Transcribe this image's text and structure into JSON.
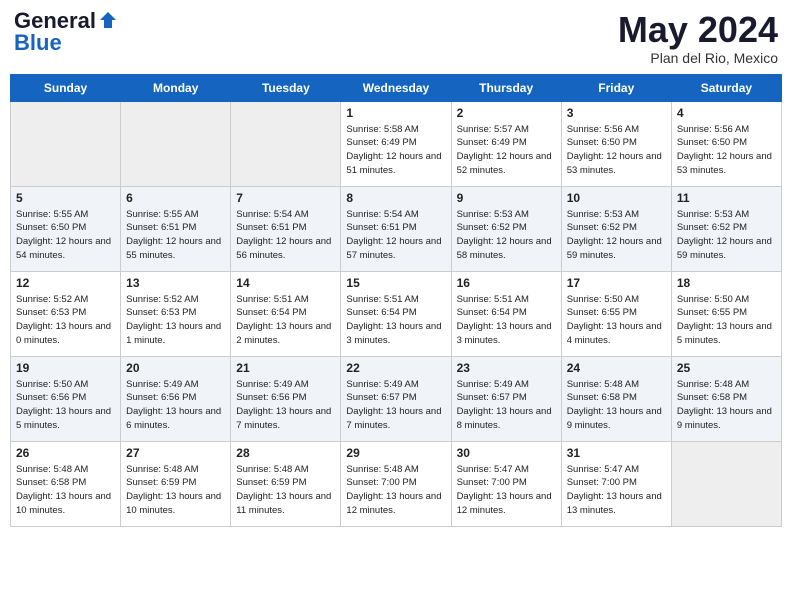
{
  "header": {
    "logo_general": "General",
    "logo_blue": "Blue",
    "month_title": "May 2024",
    "location": "Plan del Rio, Mexico"
  },
  "days_of_week": [
    "Sunday",
    "Monday",
    "Tuesday",
    "Wednesday",
    "Thursday",
    "Friday",
    "Saturday"
  ],
  "weeks": [
    {
      "row_class": "row-odd",
      "cells": [
        {
          "day": "",
          "empty": true
        },
        {
          "day": "",
          "empty": true
        },
        {
          "day": "",
          "empty": true
        },
        {
          "day": "1",
          "sunrise": "5:58 AM",
          "sunset": "6:49 PM",
          "daylight": "12 hours and 51 minutes."
        },
        {
          "day": "2",
          "sunrise": "5:57 AM",
          "sunset": "6:49 PM",
          "daylight": "12 hours and 52 minutes."
        },
        {
          "day": "3",
          "sunrise": "5:56 AM",
          "sunset": "6:50 PM",
          "daylight": "12 hours and 53 minutes."
        },
        {
          "day": "4",
          "sunrise": "5:56 AM",
          "sunset": "6:50 PM",
          "daylight": "12 hours and 53 minutes."
        }
      ]
    },
    {
      "row_class": "row-even",
      "cells": [
        {
          "day": "5",
          "sunrise": "5:55 AM",
          "sunset": "6:50 PM",
          "daylight": "12 hours and 54 minutes."
        },
        {
          "day": "6",
          "sunrise": "5:55 AM",
          "sunset": "6:51 PM",
          "daylight": "12 hours and 55 minutes."
        },
        {
          "day": "7",
          "sunrise": "5:54 AM",
          "sunset": "6:51 PM",
          "daylight": "12 hours and 56 minutes."
        },
        {
          "day": "8",
          "sunrise": "5:54 AM",
          "sunset": "6:51 PM",
          "daylight": "12 hours and 57 minutes."
        },
        {
          "day": "9",
          "sunrise": "5:53 AM",
          "sunset": "6:52 PM",
          "daylight": "12 hours and 58 minutes."
        },
        {
          "day": "10",
          "sunrise": "5:53 AM",
          "sunset": "6:52 PM",
          "daylight": "12 hours and 59 minutes."
        },
        {
          "day": "11",
          "sunrise": "5:53 AM",
          "sunset": "6:52 PM",
          "daylight": "12 hours and 59 minutes."
        }
      ]
    },
    {
      "row_class": "row-odd",
      "cells": [
        {
          "day": "12",
          "sunrise": "5:52 AM",
          "sunset": "6:53 PM",
          "daylight": "13 hours and 0 minutes."
        },
        {
          "day": "13",
          "sunrise": "5:52 AM",
          "sunset": "6:53 PM",
          "daylight": "13 hours and 1 minute."
        },
        {
          "day": "14",
          "sunrise": "5:51 AM",
          "sunset": "6:54 PM",
          "daylight": "13 hours and 2 minutes."
        },
        {
          "day": "15",
          "sunrise": "5:51 AM",
          "sunset": "6:54 PM",
          "daylight": "13 hours and 3 minutes."
        },
        {
          "day": "16",
          "sunrise": "5:51 AM",
          "sunset": "6:54 PM",
          "daylight": "13 hours and 3 minutes."
        },
        {
          "day": "17",
          "sunrise": "5:50 AM",
          "sunset": "6:55 PM",
          "daylight": "13 hours and 4 minutes."
        },
        {
          "day": "18",
          "sunrise": "5:50 AM",
          "sunset": "6:55 PM",
          "daylight": "13 hours and 5 minutes."
        }
      ]
    },
    {
      "row_class": "row-even",
      "cells": [
        {
          "day": "19",
          "sunrise": "5:50 AM",
          "sunset": "6:56 PM",
          "daylight": "13 hours and 5 minutes."
        },
        {
          "day": "20",
          "sunrise": "5:49 AM",
          "sunset": "6:56 PM",
          "daylight": "13 hours and 6 minutes."
        },
        {
          "day": "21",
          "sunrise": "5:49 AM",
          "sunset": "6:56 PM",
          "daylight": "13 hours and 7 minutes."
        },
        {
          "day": "22",
          "sunrise": "5:49 AM",
          "sunset": "6:57 PM",
          "daylight": "13 hours and 7 minutes."
        },
        {
          "day": "23",
          "sunrise": "5:49 AM",
          "sunset": "6:57 PM",
          "daylight": "13 hours and 8 minutes."
        },
        {
          "day": "24",
          "sunrise": "5:48 AM",
          "sunset": "6:58 PM",
          "daylight": "13 hours and 9 minutes."
        },
        {
          "day": "25",
          "sunrise": "5:48 AM",
          "sunset": "6:58 PM",
          "daylight": "13 hours and 9 minutes."
        }
      ]
    },
    {
      "row_class": "row-odd",
      "cells": [
        {
          "day": "26",
          "sunrise": "5:48 AM",
          "sunset": "6:58 PM",
          "daylight": "13 hours and 10 minutes."
        },
        {
          "day": "27",
          "sunrise": "5:48 AM",
          "sunset": "6:59 PM",
          "daylight": "13 hours and 10 minutes."
        },
        {
          "day": "28",
          "sunrise": "5:48 AM",
          "sunset": "6:59 PM",
          "daylight": "13 hours and 11 minutes."
        },
        {
          "day": "29",
          "sunrise": "5:48 AM",
          "sunset": "7:00 PM",
          "daylight": "13 hours and 12 minutes."
        },
        {
          "day": "30",
          "sunrise": "5:47 AM",
          "sunset": "7:00 PM",
          "daylight": "13 hours and 12 minutes."
        },
        {
          "day": "31",
          "sunrise": "5:47 AM",
          "sunset": "7:00 PM",
          "daylight": "13 hours and 13 minutes."
        },
        {
          "day": "",
          "empty": true
        }
      ]
    }
  ]
}
